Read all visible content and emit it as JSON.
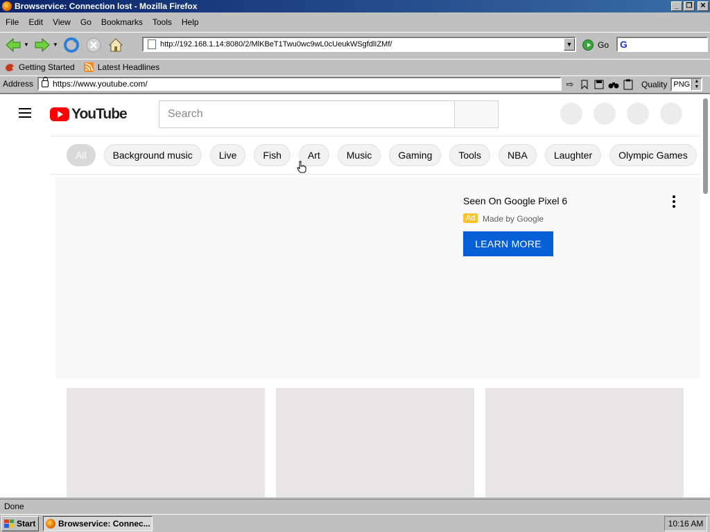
{
  "window": {
    "title": "Browservice: Connection lost - Mozilla Firefox",
    "min": "_",
    "max": "❐",
    "close": "✕"
  },
  "menu": [
    "File",
    "Edit",
    "View",
    "Go",
    "Bookmarks",
    "Tools",
    "Help"
  ],
  "nav": {
    "url": "http://192.168.1.14:8080/2/MlKBeT1Twu0wc9wL0cUeukWSgfdlIZMf/",
    "go_label": "Go"
  },
  "bookmarks": [
    "Getting Started",
    "Latest Headlines"
  ],
  "address": {
    "label": "Address",
    "url": "https://www.youtube.com/",
    "quality_label": "Quality",
    "quality_value": "PNG"
  },
  "youtube": {
    "logo_text": "YouTube",
    "search_placeholder": "Search",
    "chips": [
      "All",
      "Background music",
      "Live",
      "Fish",
      "Art",
      "Music",
      "Gaming",
      "Tools",
      "NBA",
      "Laughter",
      "Olympic Games"
    ],
    "ad": {
      "title": "Seen On Google Pixel 6",
      "badge": "Ad",
      "by": "Made by Google",
      "button": "LEARN MORE"
    }
  },
  "status": "Done",
  "taskbar": {
    "start": "Start",
    "item": "Browservice: Connec...",
    "clock": "10:16 AM"
  },
  "colors": {
    "titlebar": "#0a246a",
    "yt_red": "#ff0000",
    "ad_button": "#065fd4",
    "ad_badge": "#f9c22e"
  }
}
